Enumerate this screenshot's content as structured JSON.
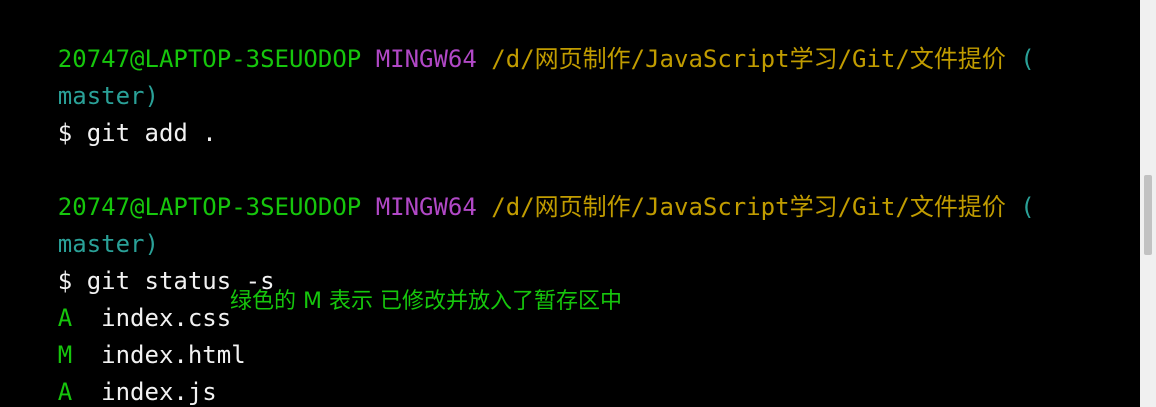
{
  "colors": {
    "background": "#000000",
    "user": "#16c60c",
    "system": "#b148c6",
    "path": "#c19c00",
    "branch": "#2aa198",
    "text": "#f2f2f2",
    "annotation": "#16c60c"
  },
  "prompt": {
    "user_host": "20747@LAPTOP-3SEUODOP",
    "system": "MINGW64",
    "path": "/d/网页制作/JavaScript学习/Git/文件提价",
    "branch_open": "(",
    "branch_name": "master)"
  },
  "commands": [
    {
      "symbol": "$",
      "text": "git add ."
    },
    {
      "symbol": "$",
      "text": "git status -s"
    }
  ],
  "status_output": [
    {
      "code": "A",
      "file": "index.css"
    },
    {
      "code": "M",
      "file": "index.html"
    },
    {
      "code": "A",
      "file": "index.js"
    }
  ],
  "annotation": "绿色的 M 表示 已修改并放入了暂存区中"
}
